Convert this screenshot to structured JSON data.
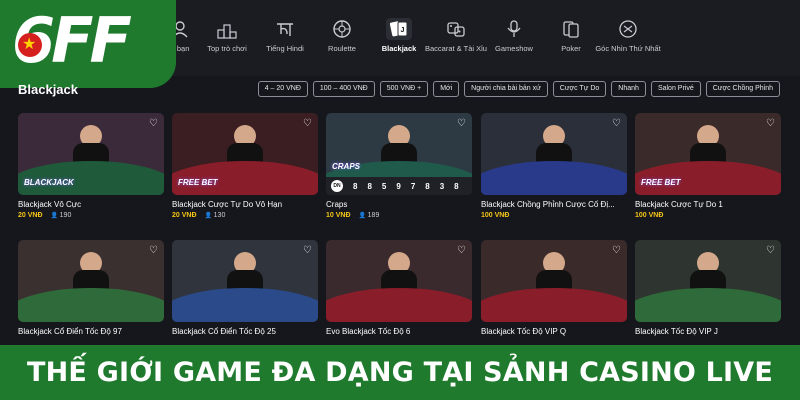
{
  "brand": {
    "logo_text": "6FF"
  },
  "nav": {
    "items": [
      {
        "label": "o bạn",
        "icon": "user-icon"
      },
      {
        "label": "Top trò chơi",
        "icon": "podium-icon"
      },
      {
        "label": "Tiếng Hindi",
        "icon": "hindi-icon"
      },
      {
        "label": "Roulette",
        "icon": "roulette-icon"
      },
      {
        "label": "Blackjack",
        "icon": "cards-icon",
        "active": true
      },
      {
        "label": "Baccarat & Tài Xỉu",
        "icon": "dice-icon"
      },
      {
        "label": "Gameshow",
        "icon": "microphone-icon"
      },
      {
        "label": "Poker",
        "icon": "poker-icon"
      },
      {
        "label": "Góc Nhìn Thứ Nhất",
        "icon": "first-person-icon"
      }
    ]
  },
  "page": {
    "title": "Blackjack"
  },
  "filters": [
    "4 – 20 VNĐ",
    "100 – 400 VNĐ",
    "500 VNĐ +",
    "Mới",
    "Người chia bài bản xứ",
    "Cược Tự Do",
    "Nhanh",
    "Salon Privé",
    "Cược Chồng Phỉnh"
  ],
  "games": [
    {
      "name": "Blackjack Vô Cực",
      "bet": "20 VNĐ",
      "players": "190",
      "badge": "BLACKJACK",
      "felt": "#1f5a3a",
      "bg": "#3b2a3a"
    },
    {
      "name": "Blackjack Cược Tự Do Vô Hạn",
      "bet": "20 VNĐ",
      "players": "130",
      "badge": "FREE BET",
      "felt": "#8a1d2a",
      "bg": "#3a1e22"
    },
    {
      "name": "Craps",
      "bet": "10 VNĐ",
      "players": "189",
      "badge": "CRAPS",
      "felt": "#1f5a4a",
      "bg": "#2d3a44",
      "road": [
        "DN",
        "8",
        "8",
        "5",
        "9",
        "7",
        "8",
        "3",
        "8"
      ]
    },
    {
      "name": "Blackjack Chồng Phỉnh Cược Cố Đị...",
      "bet": "100 VNĐ",
      "players": "",
      "badge": "",
      "felt": "#2a3a8a",
      "bg": "#2a2f3a"
    },
    {
      "name": "Blackjack Cược Tự Do 1",
      "bet": "100 VNĐ",
      "players": "",
      "badge": "FREE BET",
      "felt": "#8a1d2a",
      "bg": "#3a2a2a"
    },
    {
      "name": "Blackjack Cổ Điển Tốc Độ 97",
      "bet": "",
      "players": "",
      "badge": "",
      "felt": "#2f6a3a",
      "bg": "#3a3030"
    },
    {
      "name": "Blackjack Cổ Điển Tốc Độ 25",
      "bet": "",
      "players": "",
      "badge": "",
      "felt": "#2a4a8a",
      "bg": "#30353d"
    },
    {
      "name": "Evo Blackjack Tốc Độ 6",
      "bet": "",
      "players": "",
      "badge": "",
      "felt": "#8a1d2a",
      "bg": "#3a2a2e"
    },
    {
      "name": "Blackjack Tốc Độ VIP Q",
      "bet": "",
      "players": "",
      "badge": "",
      "felt": "#8a1d2a",
      "bg": "#3a2a2a"
    },
    {
      "name": "Blackjack Tốc Độ VIP J",
      "bet": "",
      "players": "",
      "badge": "",
      "felt": "#2f6a3a",
      "bg": "#2e3530"
    }
  ],
  "banner": {
    "text": "THẾ GIỚI GAME ĐA DẠNG TẠI SẢNH CASINO LIVE"
  },
  "colors": {
    "brand_green": "#1f7a2e",
    "bet_yellow": "#f5c518",
    "background": "#15171c"
  }
}
